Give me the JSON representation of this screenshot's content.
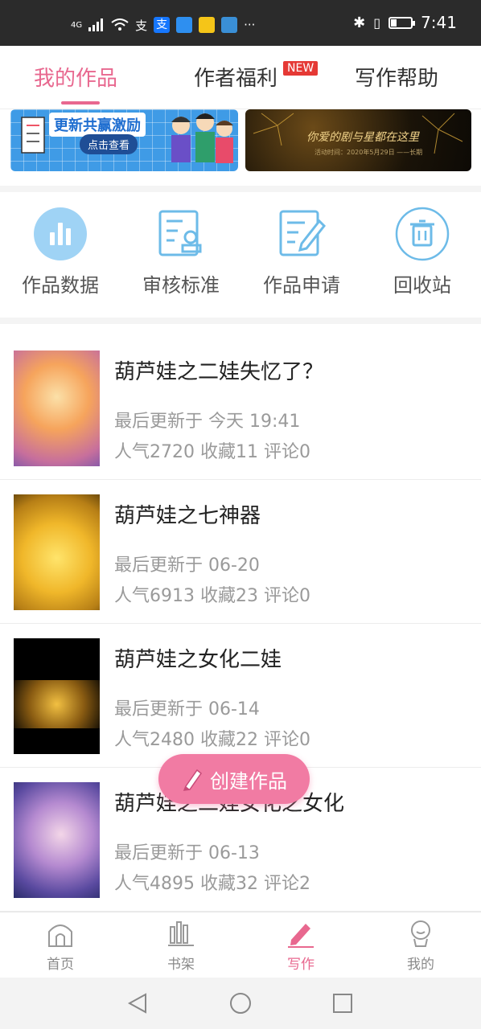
{
  "status_bar": {
    "time": "7:41",
    "signal": "4G",
    "dots": "···",
    "battery_level": 0.25,
    "app_icons": [
      "alipay-text-icon",
      "alipay-icon",
      "dingtalk-icon",
      "weibo-icon",
      "bird-icon"
    ]
  },
  "tabs": [
    {
      "label": "我的作品",
      "active": true
    },
    {
      "label": "作者福利",
      "badge": "NEW"
    },
    {
      "label": "写作帮助"
    }
  ],
  "banners": {
    "left": {
      "title": "更新共赢激励",
      "button": "点击查看"
    },
    "right": {
      "subtitle": "你爱的剧与星都在这里",
      "small": "活动时间：2020年5月29日 ——长期"
    }
  },
  "quick_actions": [
    {
      "label": "作品数据",
      "icon": "chart-icon"
    },
    {
      "label": "审核标准",
      "icon": "review-doc-icon"
    },
    {
      "label": "作品申请",
      "icon": "edit-doc-icon"
    },
    {
      "label": "回收站",
      "icon": "trash-icon"
    }
  ],
  "works": [
    {
      "title": "葫芦娃之二娃失忆了？",
      "updated": "最后更新于 今天 19:41",
      "stats": "人气2720 收藏11 评论0"
    },
    {
      "title": "葫芦娃之七神器",
      "updated": "最后更新于 06-20",
      "stats": "人气6913 收藏23 评论0"
    },
    {
      "title": "葫芦娃之女化二娃",
      "updated": "最后更新于 06-14",
      "stats": "人气2480 收藏22 评论0"
    },
    {
      "title": "葫芦娃之二娃女化之女化",
      "updated": "最后更新于 06-13",
      "stats": "人气4895 收藏32 评论2"
    }
  ],
  "fab": {
    "label": "创建作品"
  },
  "bottom_nav": [
    {
      "label": "首页",
      "icon": "home-icon"
    },
    {
      "label": "书架",
      "icon": "bookshelf-icon"
    },
    {
      "label": "写作",
      "icon": "pen-icon",
      "active": true
    },
    {
      "label": "我的",
      "icon": "profile-icon"
    }
  ],
  "colors": {
    "accent": "#e8688f",
    "fab": "#f17ba3",
    "icon_blue": "#5fb3e8"
  }
}
